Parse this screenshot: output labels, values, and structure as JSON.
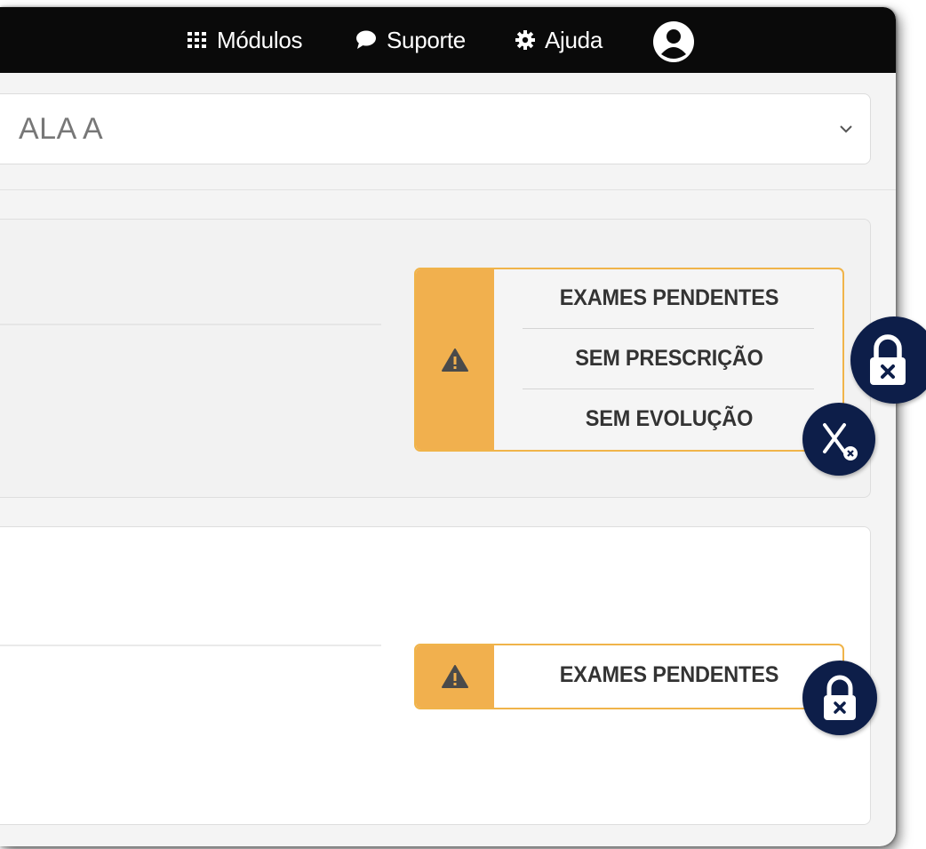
{
  "topbar": {
    "modules_label": "Módulos",
    "support_label": "Suporte",
    "help_label": "Ajuda"
  },
  "ward_select": {
    "value": "ALA A"
  },
  "patient_cards": [
    {
      "alerts": [
        "EXAMES PENDENTES",
        "SEM PRESCRIÇÃO",
        "SEM EVOLUÇÃO"
      ]
    },
    {
      "alerts": [
        "EXAMES PENDENTES"
      ]
    }
  ],
  "colors": {
    "topbar": "#0a0a0a",
    "alert_accent": "#f1b04e",
    "fab": "#0d1e49"
  },
  "icons": {
    "modules": "grid-icon",
    "support": "chat-bubble-icon",
    "help": "gear-icon",
    "user": "user-avatar-icon",
    "warning": "warning-icon",
    "lock": "lock-icon",
    "close": "x-close-icon"
  }
}
